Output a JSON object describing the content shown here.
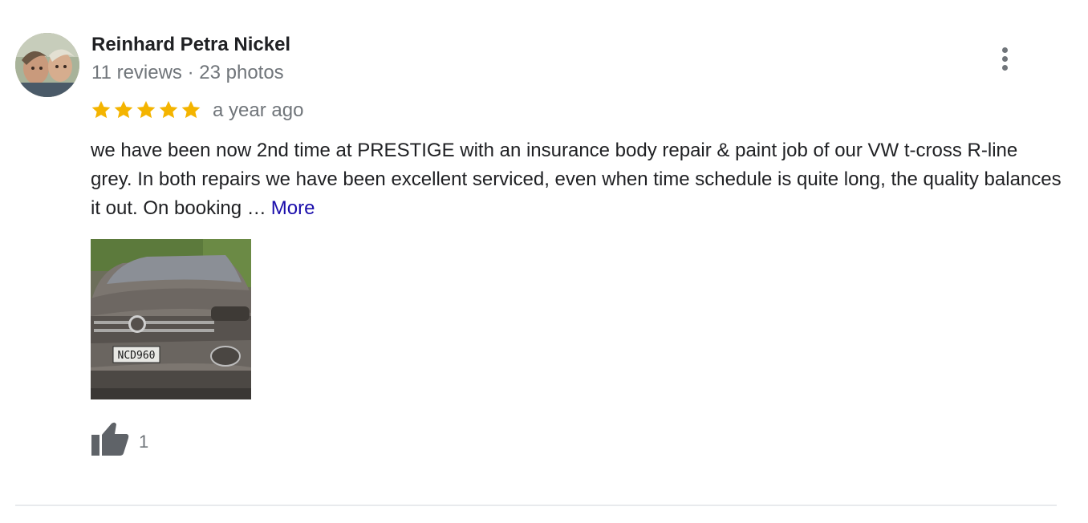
{
  "review": {
    "author_name": "Reinhard Petra Nickel",
    "author_meta": "11 reviews · 23 photos",
    "rating": 5,
    "rating_max": 5,
    "time_ago": "a year ago",
    "text": "we have been now 2nd time at PRESTIGE with an insurance body repair & paint job of our VW t-cross R-line grey. In both repairs we have been excellent serviced, even when time schedule is quite long, the quality balances it out. On booking …",
    "more_label": "More",
    "likes": "1",
    "photo_plate": "NCD960"
  },
  "colors": {
    "star": "#f4b400",
    "link": "#1a0dab",
    "secondary_text": "#70757a",
    "primary_text": "#202124",
    "divider": "#e8eaed"
  },
  "icons": {
    "menu": "more-vert-icon",
    "star": "star-icon",
    "like": "thumb-up-icon"
  }
}
